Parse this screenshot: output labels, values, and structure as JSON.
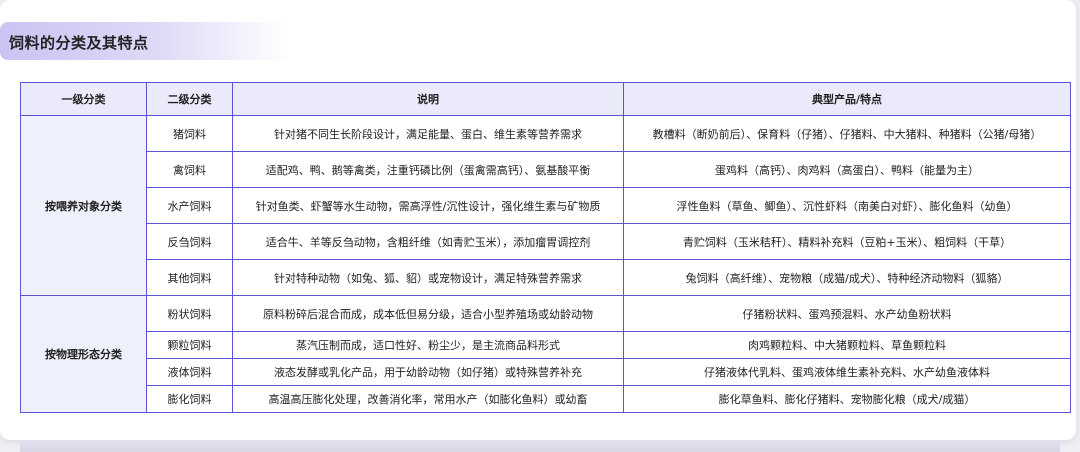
{
  "title": "饲料的分类及其特点",
  "headers": [
    "一级分类",
    "二级分类",
    "说明",
    "典型产品/特点"
  ],
  "groups": [
    {
      "category": "按喂养对象分类",
      "rows": [
        {
          "sub": "猪饲料",
          "desc": "针对猪不同生长阶段设计，满足能量、蛋白、维生素等营养需求",
          "prod": "教槽料（断奶前后）、保育料（仔猪）、仔猪料、中大猪料、种猪料（公猪/母猪）"
        },
        {
          "sub": "禽饲料",
          "desc": "适配鸡、鸭、鹅等禽类，注重钙磷比例（蛋禽需高钙）、氨基酸平衡",
          "prod": "蛋鸡料（高钙）、肉鸡料（高蛋白）、鸭料（能量为主）"
        },
        {
          "sub": "水产饲料",
          "desc": "针对鱼类、虾蟹等水生动物，需高浮性/沉性设计，强化维生素与矿物质",
          "prod": "浮性鱼料（草鱼、鲫鱼）、沉性虾料（南美白对虾）、膨化鱼料（幼鱼）"
        },
        {
          "sub": "反刍饲料",
          "desc": "适合牛、羊等反刍动物，含粗纤维（如青贮玉米），添加瘤胃调控剂",
          "prod": "青贮饲料（玉米秸秆）、精料补充料（豆粕+玉米）、粗饲料（干草）"
        },
        {
          "sub": "其他饲料",
          "desc": "针对特种动物（如兔、狐、貂）或宠物设计，满足特殊营养需求",
          "prod": "兔饲料（高纤维）、宠物粮（成猫/成犬）、特种经济动物料（狐貉）"
        }
      ]
    },
    {
      "category": "按物理形态分类",
      "rows": [
        {
          "sub": "粉状饲料",
          "desc": "原料粉碎后混合而成，成本低但易分级，适合小型养殖场或幼龄动物",
          "prod": "仔猪粉状料、蛋鸡预混料、水产幼鱼粉状料"
        },
        {
          "sub": "颗粒饲料",
          "desc": "蒸汽压制而成，适口性好、粉尘少，是主流商品料形式",
          "prod": "肉鸡颗粒料、中大猪颗粒料、草鱼颗粒料"
        },
        {
          "sub": "液体饲料",
          "desc": "液态发酵或乳化产品，用于幼龄动物（如仔猪）或特殊营养补充",
          "prod": "仔猪液体代乳料、蛋鸡液体维生素补充料、水产幼鱼液体料"
        },
        {
          "sub": "膨化饲料",
          "desc": "高温高压膨化处理，改善消化率，常用水产（如膨化鱼料）或幼畜",
          "prod": "膨化草鱼料、膨化仔猪料、宠物膨化粮（成犬/成猫）"
        }
      ]
    }
  ]
}
